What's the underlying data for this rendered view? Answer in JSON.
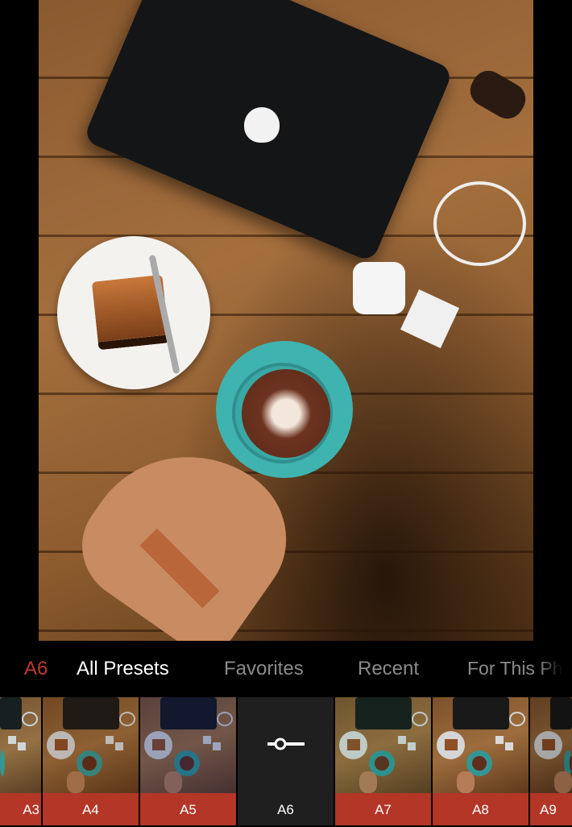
{
  "current_preset": "A6",
  "tabs": [
    {
      "label": "All Presets",
      "active": true
    },
    {
      "label": "Favorites",
      "active": false
    },
    {
      "label": "Recent",
      "active": false
    },
    {
      "label": "For This Ph",
      "active": false
    }
  ],
  "presets": [
    {
      "label": "A3"
    },
    {
      "label": "A4"
    },
    {
      "label": "A5"
    },
    {
      "label": "A6",
      "selected": true,
      "icon": "slider-adjust-icon"
    },
    {
      "label": "A7"
    },
    {
      "label": "A8"
    },
    {
      "label": "A9"
    }
  ],
  "colors": {
    "accent": "#b33627",
    "active_preset_text": "#c0392b",
    "background": "#000000"
  }
}
